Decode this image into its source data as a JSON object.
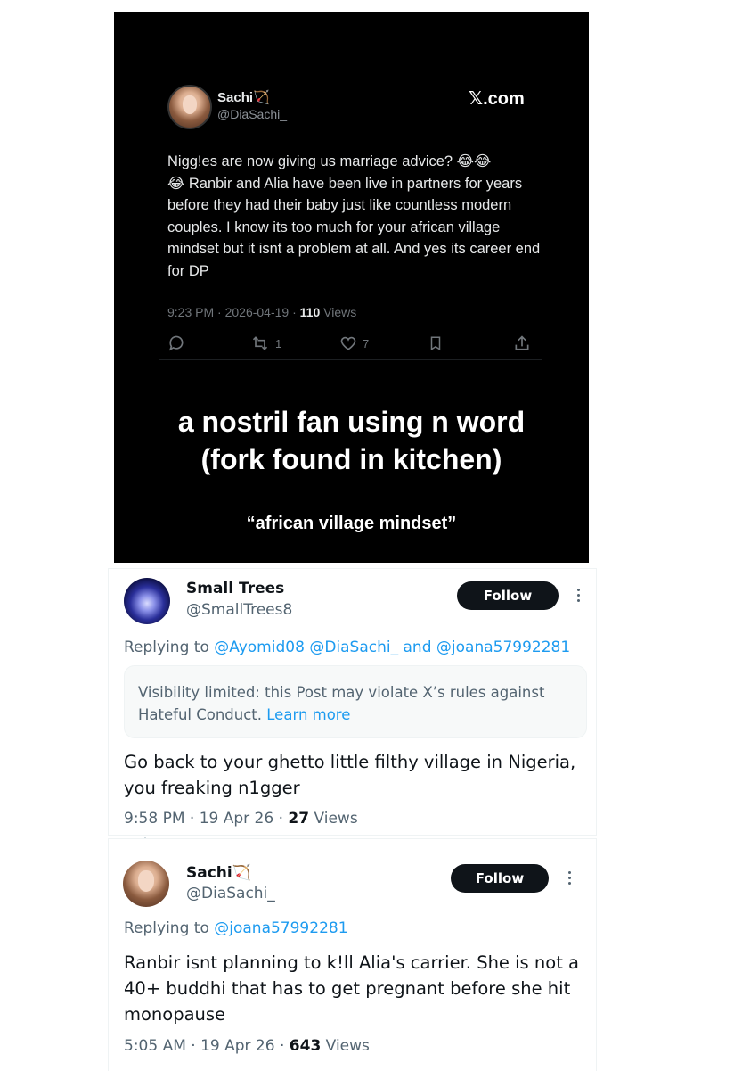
{
  "screenshot_post": {
    "author_name": "Sachi🏹",
    "author_handle": "@DiaSachi_",
    "brand": "𝕏.com",
    "text": "Nigg!es are now giving us marriage advice? 😂😂\n😂 Ranbir and Alia have been live in partners for years before they had their baby just like countless modern couples. I know its too much for your african village mindset but it isnt a problem at all. And yes its career end for DP",
    "timestamp": "9:23 PM · 2026-04-19 · ",
    "views_count": "110",
    "views_label": " Views",
    "retweets": "1",
    "likes": "7",
    "icons": [
      "reply-icon",
      "retweet-icon",
      "like-icon",
      "bookmark-icon",
      "share-icon"
    ]
  },
  "caption": {
    "line1": "a nostril fan using n word",
    "line2": "(fork found in kitchen)",
    "quote": "“african village mindset”"
  },
  "tweet1": {
    "author_name": "Small Trees",
    "author_handle": "@SmallTrees8",
    "follow_label": "Follow",
    "replying_to_label": "Replying to ",
    "mentions": [
      "@Ayomid08",
      "@DiaSachi_",
      "@joana57992281"
    ],
    "mention_separator": " ",
    "mention_joiner": " and ",
    "visibility_notice": "Visibility limited: this Post may violate X’s rules against Hateful Conduct. ",
    "learn_more": "Learn more",
    "body": "Go back to your ghetto little filthy village in Nigeria, you freaking n1gger",
    "timestamp": "9:58 PM · 19 Apr 26 · ",
    "views_count": "27",
    "views_label": " Views"
  },
  "tweet2": {
    "author_name": "Sachi🏹",
    "author_handle": "@DiaSachi_",
    "follow_label": "Follow",
    "replying_to_label": "Replying to ",
    "mention": "@joana57992281",
    "body": "Ranbir isnt planning to k!ll Alia's carrier. She is not a 40+ buddhi that has to get pregnant before she hit monopause",
    "timestamp": "5:05 AM · 19 Apr 26 · ",
    "views_count": "643",
    "views_label": " Views"
  },
  "colors": {
    "dark_bg": "#000000",
    "link_blue": "#1d9bf0",
    "muted_gray": "#536471",
    "follow_button": "#0f1419"
  }
}
